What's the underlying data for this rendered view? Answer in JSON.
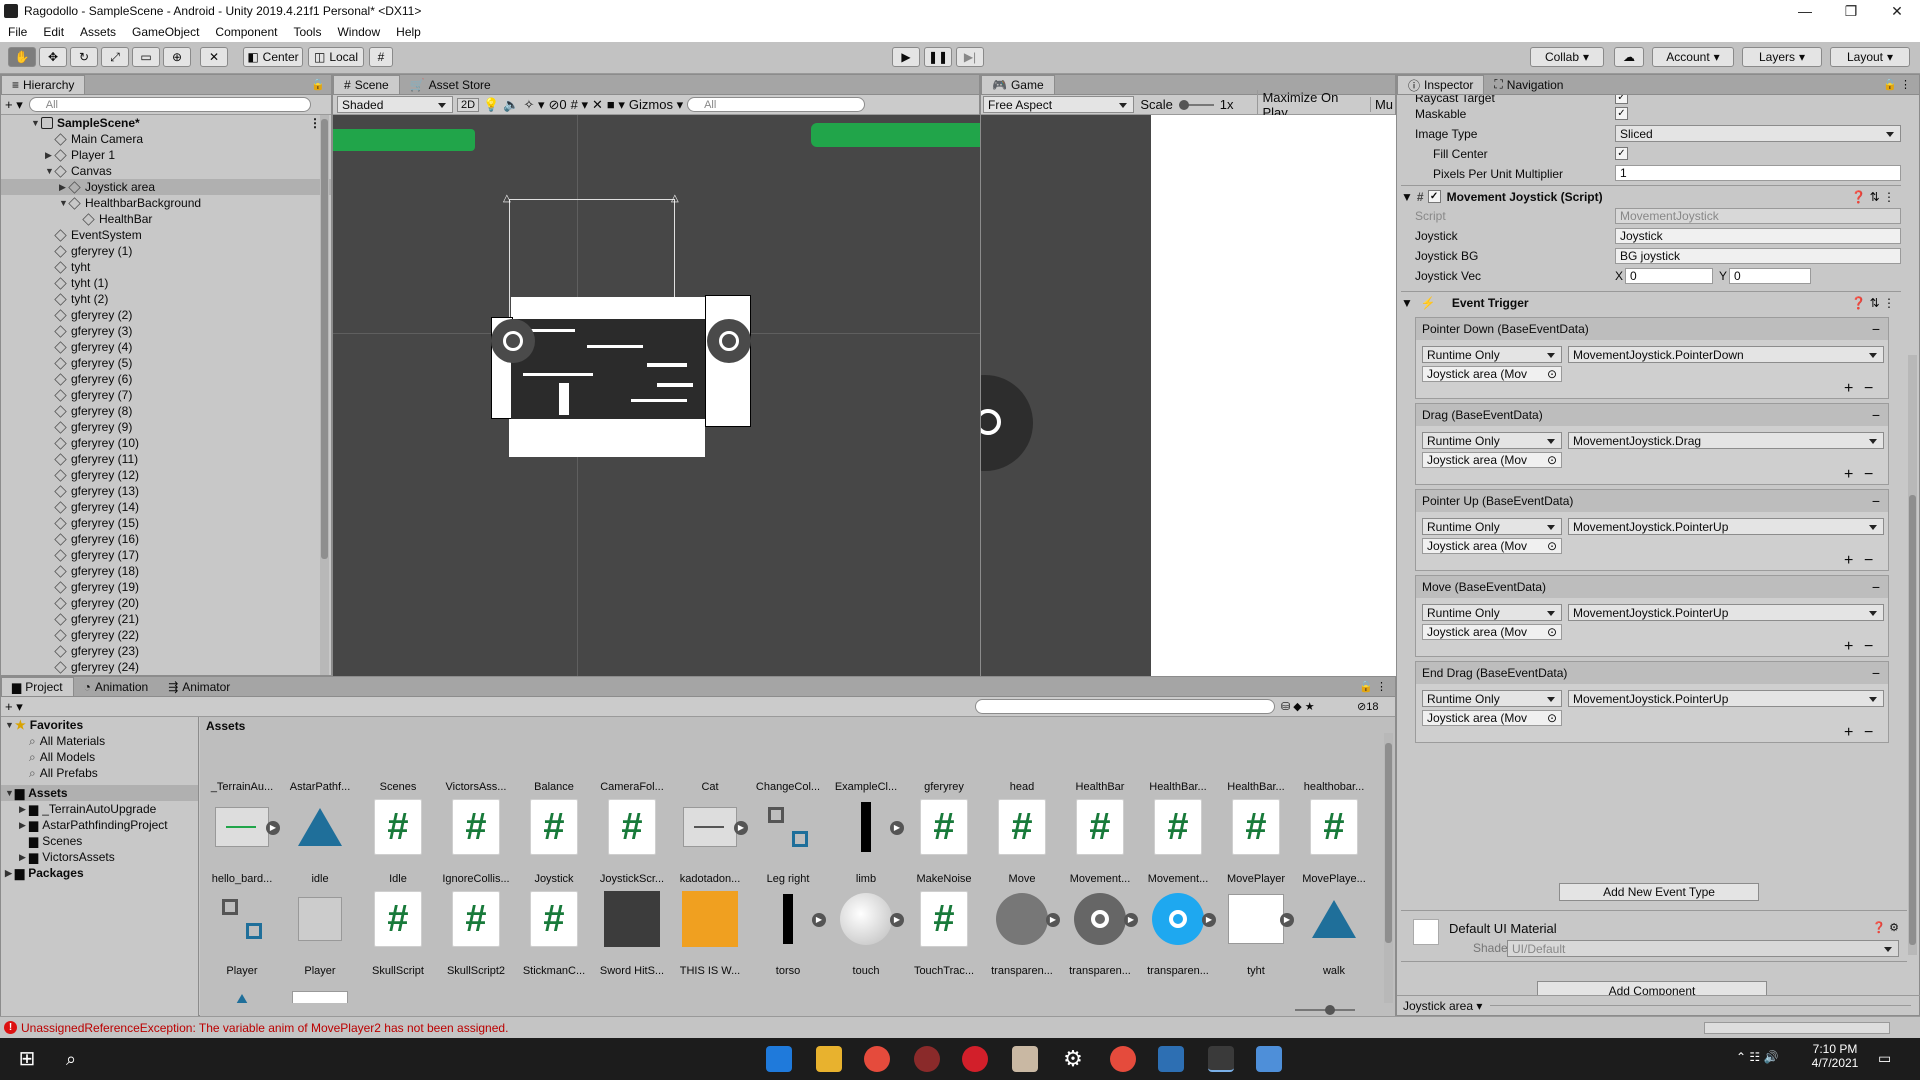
{
  "window": {
    "title": "Ragodollo - SampleScene - Android - Unity 2019.4.21f1 Personal* <DX11>",
    "controls": [
      "—",
      "❐",
      "✕"
    ]
  },
  "menu": [
    "File",
    "Edit",
    "Assets",
    "GameObject",
    "Component",
    "Tools",
    "Window",
    "Help"
  ],
  "toolbar": {
    "pivot": "Center",
    "space": "Local",
    "collab": "Collab",
    "account": "Account",
    "layers": "Layers",
    "layout": "Layout"
  },
  "hierarchy": {
    "tab": "Hierarchy",
    "search_placeholder": "All",
    "scene": "SampleScene*",
    "items": [
      {
        "label": "Main Camera",
        "indent": 1
      },
      {
        "label": "Player 1",
        "indent": 1,
        "arrow": "▶"
      },
      {
        "label": "Canvas",
        "indent": 1,
        "arrow": "▼"
      },
      {
        "label": "Joystick area",
        "indent": 2,
        "arrow": "▶",
        "selected": true
      },
      {
        "label": "HealthbarBackground",
        "indent": 2,
        "arrow": "▼"
      },
      {
        "label": "HealthBar",
        "indent": 3
      },
      {
        "label": "EventSystem",
        "indent": 1
      },
      {
        "label": "gferyrey (1)",
        "indent": 1
      },
      {
        "label": "tyht",
        "indent": 1
      },
      {
        "label": "tyht (1)",
        "indent": 1
      },
      {
        "label": "tyht (2)",
        "indent": 1
      },
      {
        "label": "gferyrey (2)",
        "indent": 1
      },
      {
        "label": "gferyrey (3)",
        "indent": 1
      },
      {
        "label": "gferyrey (4)",
        "indent": 1
      },
      {
        "label": "gferyrey (5)",
        "indent": 1
      },
      {
        "label": "gferyrey (6)",
        "indent": 1
      },
      {
        "label": "gferyrey (7)",
        "indent": 1
      },
      {
        "label": "gferyrey (8)",
        "indent": 1
      },
      {
        "label": "gferyrey (9)",
        "indent": 1
      },
      {
        "label": "gferyrey (10)",
        "indent": 1
      },
      {
        "label": "gferyrey (11)",
        "indent": 1
      },
      {
        "label": "gferyrey (12)",
        "indent": 1
      },
      {
        "label": "gferyrey (13)",
        "indent": 1
      },
      {
        "label": "gferyrey (14)",
        "indent": 1
      },
      {
        "label": "gferyrey (15)",
        "indent": 1
      },
      {
        "label": "gferyrey (16)",
        "indent": 1
      },
      {
        "label": "gferyrey (17)",
        "indent": 1
      },
      {
        "label": "gferyrey (18)",
        "indent": 1
      },
      {
        "label": "gferyrey (19)",
        "indent": 1
      },
      {
        "label": "gferyrey (20)",
        "indent": 1
      },
      {
        "label": "gferyrey (21)",
        "indent": 1
      },
      {
        "label": "gferyrey (22)",
        "indent": 1
      },
      {
        "label": "gferyrey (23)",
        "indent": 1
      },
      {
        "label": "gferyrey (24)",
        "indent": 1
      }
    ]
  },
  "scene": {
    "tabs": [
      "Scene",
      "Asset Store"
    ],
    "shading": "Shaded",
    "mode_2d": "2D",
    "hidden_count": "0",
    "gizmos": "Gizmos",
    "search_placeholder": "All"
  },
  "game": {
    "tab": "Game",
    "aspect": "Free Aspect",
    "scale_label": "Scale",
    "scale_value": "1x",
    "maximize": "Maximize On Play",
    "mute": "Mu"
  },
  "inspector": {
    "tabs": [
      "Inspector",
      "Navigation"
    ],
    "raycast_target": "Raycast Target",
    "maskable": "Maskable",
    "image_type_label": "Image Type",
    "image_type": "Sliced",
    "fill_center": "Fill Center",
    "ppu_label": "Pixels Per Unit Multiplier",
    "ppu_value": "1",
    "component": "Movement Joystick (Script)",
    "script_label": "Script",
    "script_value": "MovementJoystick",
    "joystick_label": "Joystick",
    "joystick_value": "Joystick",
    "joystick_bg_label": "Joystick BG",
    "joystick_bg_value": "BG joystick",
    "joystick_vec_label": "Joystick Vec",
    "vec_x_label": "X",
    "vec_x": "0",
    "vec_y_label": "Y",
    "vec_y": "0",
    "event_trigger": "Event Trigger",
    "events": [
      {
        "name": "Pointer Down (BaseEventData)",
        "mode": "Runtime Only",
        "func": "MovementJoystick.PointerDown",
        "obj": "Joystick area (Mov"
      },
      {
        "name": "Drag (BaseEventData)",
        "mode": "Runtime Only",
        "func": "MovementJoystick.Drag",
        "obj": "Joystick area (Mov"
      },
      {
        "name": "Pointer Up (BaseEventData)",
        "mode": "Runtime Only",
        "func": "MovementJoystick.PointerUp",
        "obj": "Joystick area (Mov"
      },
      {
        "name": "Move (BaseEventData)",
        "mode": "Runtime Only",
        "func": "MovementJoystick.PointerUp",
        "obj": "Joystick area (Mov"
      },
      {
        "name": "End Drag (BaseEventData)",
        "mode": "Runtime Only",
        "func": "MovementJoystick.PointerUp",
        "obj": "Joystick area (Mov"
      }
    ],
    "add_event": "Add New Event Type",
    "material": "Default UI Material",
    "shader_label": "Shader",
    "shader_value": "UI/Default",
    "add_component": "Add Component",
    "footer_object": "Joystick area"
  },
  "project": {
    "tabs": [
      "Project",
      "Animation",
      "Animator"
    ],
    "hidden_count": "18",
    "favorites": "Favorites",
    "favorite_items": [
      "All Materials",
      "All Models",
      "All Prefabs"
    ],
    "assets_root": "Assets",
    "asset_folders": [
      "_TerrainAutoUpgrade",
      "AstarPathfindingProject",
      "Scenes",
      "VictorsAssets"
    ],
    "packages": "Packages",
    "breadcrumb": "Assets",
    "row1": [
      "_TerrainAu...",
      "AstarPathf...",
      "Scenes",
      "VictorsAss...",
      "Balance",
      "CameraFol...",
      "Cat",
      "ChangeCol...",
      "ExampleCl...",
      "gferyrey",
      "head",
      "HealthBar",
      "HealthBar...",
      "HealthBar...",
      "healthobar..."
    ],
    "row2": [
      "hello_bard...",
      "idle",
      "Idle",
      "IgnoreCollis...",
      "Joystick",
      "JoystickScr...",
      "kadotadon...",
      "Leg right",
      "limb",
      "MakeNoise",
      "Move",
      "Movement...",
      "Movement...",
      "MovePlayer",
      "MovePlaye..."
    ],
    "row3": [
      "Player",
      "Player",
      "SkullScript",
      "SkullScript2",
      "StickmanC...",
      "Sword HitS...",
      "THIS IS W...",
      "torso",
      "touch",
      "TouchTrac...",
      "transparen...",
      "transparen...",
      "transparen...",
      "tyht",
      "walk"
    ]
  },
  "status": {
    "error": "UnassignedReferenceException: The variable anim of MovePlayer2 has not been assigned."
  },
  "taskbar": {
    "time": "7:10 PM",
    "date": "4/7/2021"
  },
  "colors": {
    "editor_bg": "#c2c2c2",
    "scene_bg": "#474747",
    "healthbar_green": "#21a54a",
    "script_green": "#187a3a",
    "error_red": "#b00000",
    "taskbar": "#1c1c1c"
  }
}
